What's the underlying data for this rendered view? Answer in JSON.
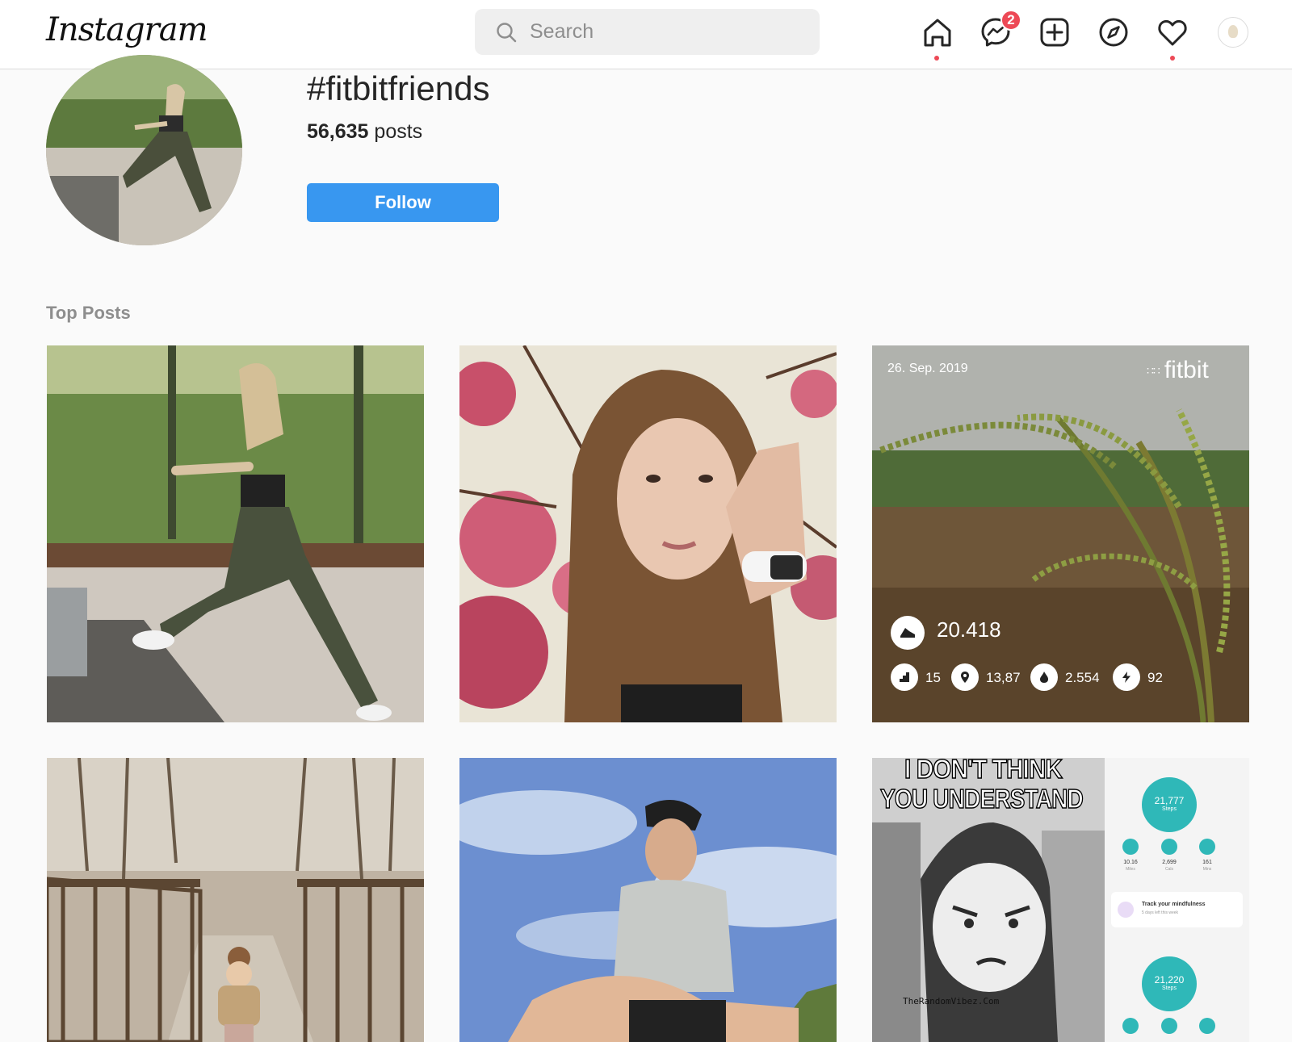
{
  "header": {
    "logo": "Instagram",
    "search_placeholder": "Search",
    "messenger_badge": "2",
    "icons": [
      "home-icon",
      "messenger-icon",
      "new-post-icon",
      "explore-icon",
      "activity-heart-icon",
      "profile-avatar"
    ]
  },
  "tag": {
    "name": "#fitbitfriends",
    "post_count": "56,635",
    "post_label": "posts",
    "follow_label": "Follow"
  },
  "top_posts": {
    "title": "Top Posts",
    "fitbit_post": {
      "date": "26. Sep. 2019",
      "brand": "fitbit",
      "steps": "20.418",
      "floors": "15",
      "distance": "13,87",
      "calories": "2.554",
      "active": "92"
    },
    "meme_post": {
      "caption_line1": "I DON'T THINK",
      "caption_line2": "YOU UNDERSTAND",
      "watermark": "TheRandomVibez.Com",
      "steps_top": "21,777",
      "steps_top_label": "Steps",
      "miles": "10.16",
      "miles_label": "Miles",
      "cals": "2,699",
      "cals_label": "Cals",
      "mins": "161",
      "mins_label": "Mins",
      "mindfulness": "Track your mindfulness",
      "mindfulness_sub": "5 days left this week",
      "steps_bottom": "21,220",
      "steps_bottom_label": "Steps"
    }
  },
  "colors": {
    "accent": "#3897f0",
    "notification": "#ed4956",
    "fitbit_teal": "#2fb8b8"
  }
}
